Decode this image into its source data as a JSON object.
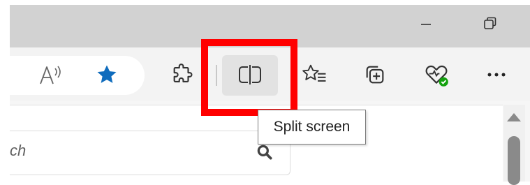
{
  "window": {
    "minimize_icon": "minimize-icon",
    "restore_icon": "restore-icon"
  },
  "toolbar": {
    "read_aloud_icon": "read-aloud-icon",
    "favorite_star_icon": "favorite-star-icon",
    "extensions_icon": "extensions-puzzle-icon",
    "split_screen_icon": "split-screen-icon",
    "favorites_icon": "favorites-list-icon",
    "collections_icon": "collections-icon",
    "browser_essentials_icon": "browser-essentials-heart-icon",
    "more_icon": "more-menu-icon",
    "star_color": "#0f6cbd",
    "essentials_badge_color": "#13a10e"
  },
  "tooltip": {
    "text": "Split screen"
  },
  "annotation": {
    "highlight_color": "#ff0000"
  },
  "search": {
    "visible_text": "ch",
    "icon": "search-icon"
  }
}
